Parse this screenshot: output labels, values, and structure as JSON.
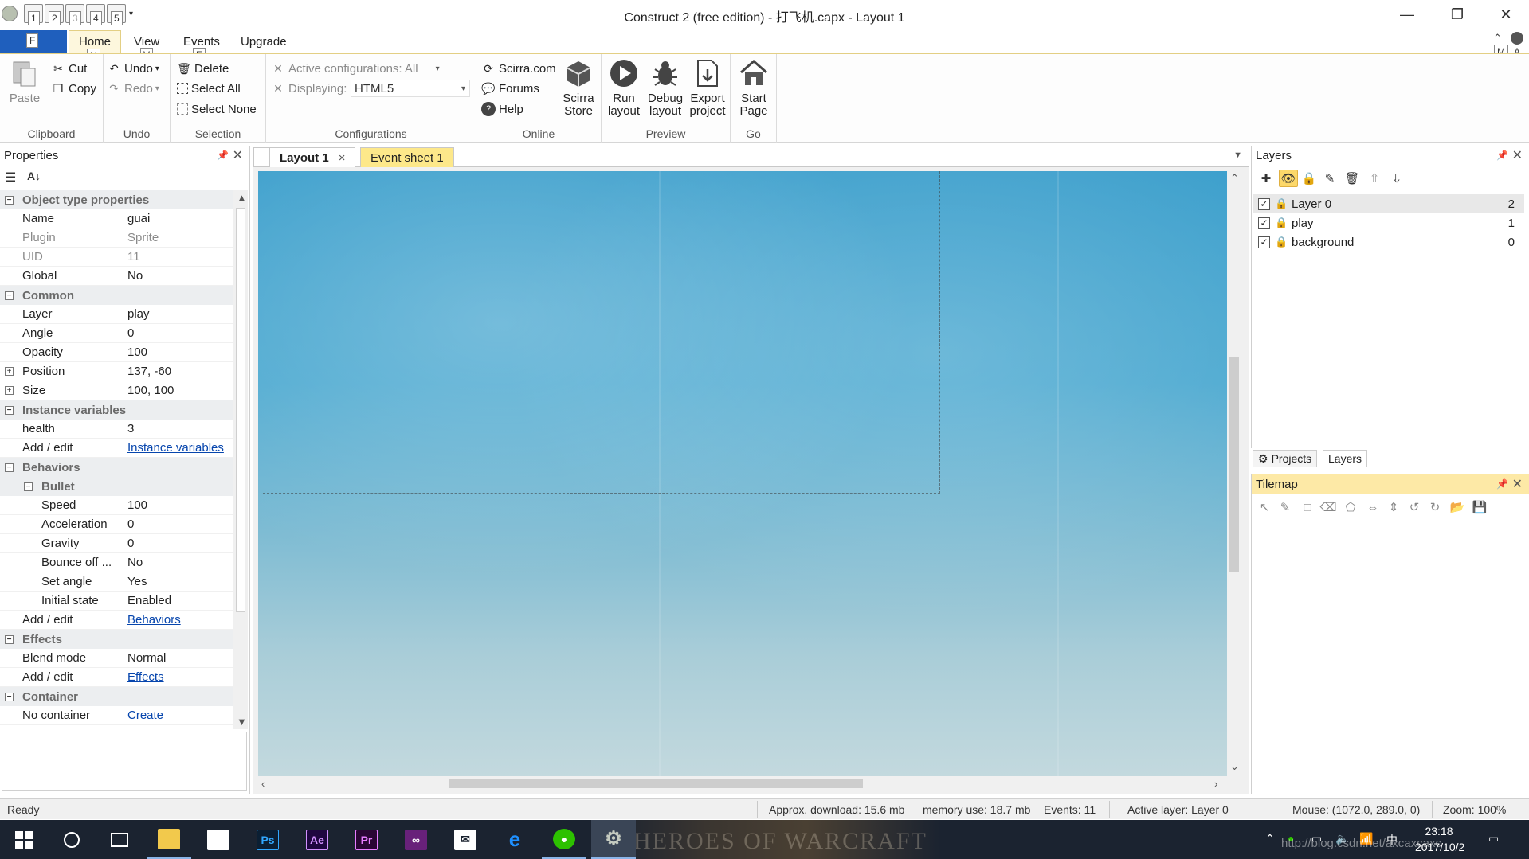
{
  "window": {
    "title": "Construct 2  (free edition) - 打飞机.capx - Layout 1",
    "minimize": "—",
    "restore": "❐",
    "close": "✕"
  },
  "qat": {
    "keytips": [
      "1",
      "2",
      "3",
      "4",
      "5"
    ],
    "file_keytip": "F"
  },
  "ribbon_tabs": {
    "file": "",
    "home": "Home",
    "view": "View",
    "events": "Events",
    "upgrade": "Upgrade",
    "home_keytip": "H",
    "view_keytip": "V",
    "events_keytip": "E",
    "right_keytips": [
      "M",
      "A"
    ]
  },
  "ribbon": {
    "clipboard": {
      "label": "Clipboard",
      "paste": "Paste",
      "cut": "Cut",
      "copy": "Copy"
    },
    "undo": {
      "label": "Undo",
      "undo": "Undo",
      "redo": "Redo"
    },
    "selection": {
      "label": "Selection",
      "delete": "Delete",
      "select_all": "Select All",
      "select_none": "Select None"
    },
    "configurations": {
      "label": "Configurations",
      "active": "Active configurations: All",
      "displaying_label": "Displaying:",
      "displaying_value": "HTML5"
    },
    "online": {
      "label": "Online",
      "scirra": "Scirra.com",
      "forums": "Forums",
      "help": "Help",
      "store_line1": "Scirra",
      "store_line2": "Store"
    },
    "preview": {
      "label": "Preview",
      "run_line1": "Run",
      "run_line2": "layout",
      "debug_line1": "Debug",
      "debug_line2": "layout",
      "export_line1": "Export",
      "export_line2": "project"
    },
    "go": {
      "label": "Go",
      "start_line1": "Start",
      "start_line2": "Page"
    }
  },
  "properties": {
    "title": "Properties",
    "rows": [
      {
        "kind": "cat",
        "name": "Object type properties",
        "expander": "−"
      },
      {
        "kind": "leaf",
        "name": "Name",
        "value": "guai"
      },
      {
        "kind": "leaf",
        "name": "Plugin",
        "value": "Sprite",
        "grey": true
      },
      {
        "kind": "leaf",
        "name": "UID",
        "value": "11",
        "grey": true
      },
      {
        "kind": "leaf",
        "name": "Global",
        "value": "No"
      },
      {
        "kind": "cat",
        "name": "Common",
        "expander": "−"
      },
      {
        "kind": "leaf",
        "name": "Layer",
        "value": "play"
      },
      {
        "kind": "leaf",
        "name": "Angle",
        "value": "0"
      },
      {
        "kind": "leaf",
        "name": "Opacity",
        "value": "100"
      },
      {
        "kind": "leaf",
        "name": "Position",
        "value": "137, -60",
        "expander": "+"
      },
      {
        "kind": "leaf",
        "name": "Size",
        "value": "100, 100",
        "expander": "+"
      },
      {
        "kind": "cat",
        "name": "Instance variables",
        "expander": "−"
      },
      {
        "kind": "leaf",
        "name": "health",
        "value": "3"
      },
      {
        "kind": "leaf",
        "name": "Add / edit",
        "value": "Instance variables",
        "link": true
      },
      {
        "kind": "cat",
        "name": "Behaviors",
        "expander": "−"
      },
      {
        "kind": "cat",
        "name": "Bullet",
        "expander": "−",
        "indent": true
      },
      {
        "kind": "leaf",
        "name": "Speed",
        "value": "100",
        "indent": true
      },
      {
        "kind": "leaf",
        "name": "Acceleration",
        "value": "0",
        "indent": true
      },
      {
        "kind": "leaf",
        "name": "Gravity",
        "value": "0",
        "indent": true
      },
      {
        "kind": "leaf",
        "name": "Bounce off ...",
        "value": "No",
        "indent": true
      },
      {
        "kind": "leaf",
        "name": "Set angle",
        "value": "Yes",
        "indent": true
      },
      {
        "kind": "leaf",
        "name": "Initial state",
        "value": "Enabled",
        "indent": true
      },
      {
        "kind": "leaf",
        "name": "Add / edit",
        "value": "Behaviors",
        "link": true
      },
      {
        "kind": "cat",
        "name": "Effects",
        "expander": "−"
      },
      {
        "kind": "leaf",
        "name": "Blend mode",
        "value": "Normal"
      },
      {
        "kind": "leaf",
        "name": "Add / edit",
        "value": "Effects",
        "link": true
      },
      {
        "kind": "cat",
        "name": "Container",
        "expander": "−"
      },
      {
        "kind": "leaf",
        "name": "No container",
        "value": "Create",
        "link": true
      }
    ]
  },
  "editor": {
    "tabs": [
      {
        "label": "Layout 1",
        "close": "×",
        "active": true
      },
      {
        "label": "Event sheet 1",
        "active": false
      }
    ]
  },
  "layers": {
    "title": "Layers",
    "items": [
      {
        "name": "Layer 0",
        "index": "2",
        "selected": true
      },
      {
        "name": "play",
        "index": "1",
        "selected": false
      },
      {
        "name": "background",
        "index": "0",
        "selected": false
      }
    ],
    "subtabs": {
      "projects": "Projects",
      "layers": "Layers"
    }
  },
  "tilemap": {
    "title": "Tilemap"
  },
  "status": {
    "ready": "Ready",
    "download": "Approx. download: 15.6 mb",
    "memory": "memory use: 18.7 mb",
    "events": "Events: 11",
    "active_layer": "Active layer: Layer 0",
    "mouse": "Mouse: (1072.0, 289.0, 0)",
    "zoom": "Zoom: 100%"
  },
  "taskbar": {
    "ps": "Ps",
    "ae": "Ae",
    "pr": "Pr",
    "art_text": "HEROES OF WARCRAFT",
    "time": "23:18",
    "date": "2017/10/2",
    "watermark": "http://blog.csdn.net/axcaxcaxc"
  },
  "colors": {
    "accent": "#1f5fbd",
    "tab_active": "#fdf7dd",
    "event_tab": "#fde88a",
    "panel_header_active": "#fde9a6",
    "link": "#0645ad"
  }
}
